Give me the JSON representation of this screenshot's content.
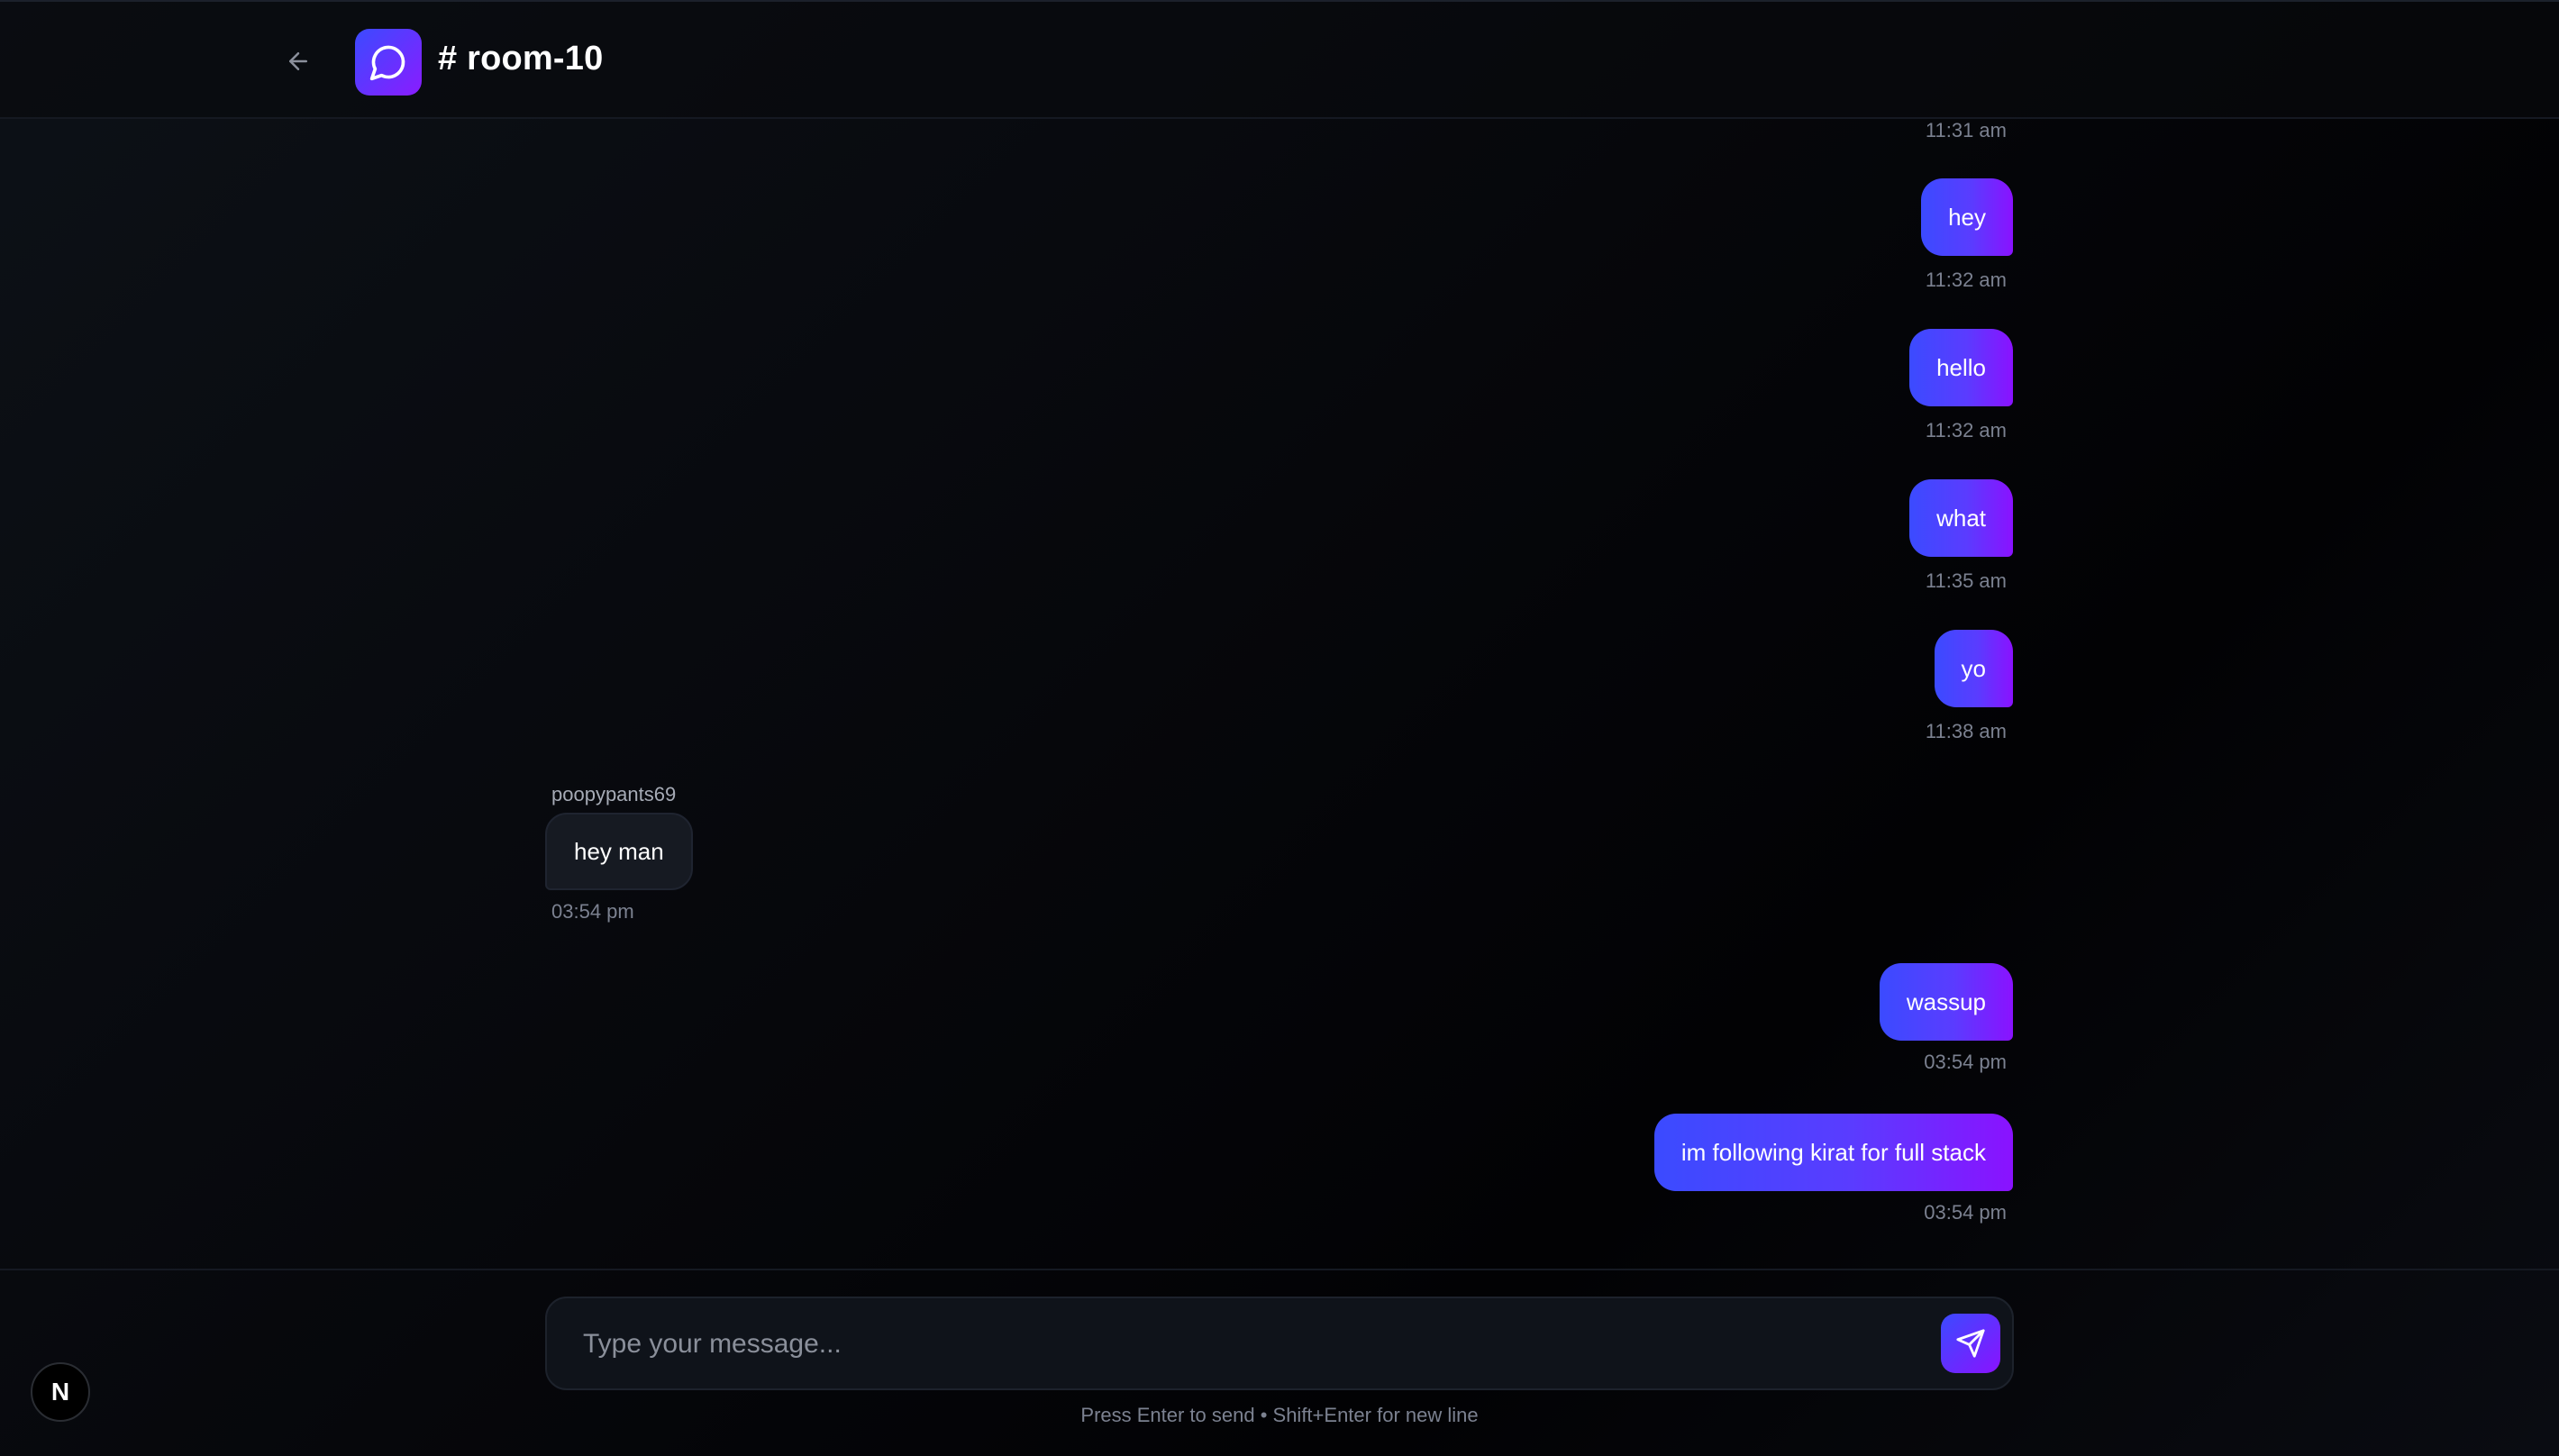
{
  "header": {
    "room_title": "# room-10"
  },
  "messages": [
    {
      "from": "me",
      "text": "",
      "time": "11:31 am"
    },
    {
      "from": "me",
      "text": "hey",
      "time": "11:32 am"
    },
    {
      "from": "me",
      "text": "hello",
      "time": "11:32 am"
    },
    {
      "from": "me",
      "text": "what",
      "time": "11:35 am"
    },
    {
      "from": "me",
      "text": "yo",
      "time": "11:38 am"
    },
    {
      "from": "other",
      "sender": "poopypants69",
      "text": "hey man",
      "time": "03:54 pm"
    },
    {
      "from": "me",
      "text": "wassup",
      "time": "03:54 pm"
    },
    {
      "from": "me",
      "text": "im following kirat for full stack",
      "time": "03:54 pm"
    }
  ],
  "composer": {
    "placeholder": "Type your message...",
    "value": "",
    "hint": "Press Enter to send • Shift+Enter for new line"
  },
  "badge": {
    "label": "N"
  },
  "colors": {
    "accent_start": "#3b4bff",
    "accent_end": "#8a12ff",
    "background": "#05060a"
  },
  "icons": {
    "back": "arrow-left-icon",
    "logo": "chat-bubble-icon",
    "send": "send-icon"
  }
}
